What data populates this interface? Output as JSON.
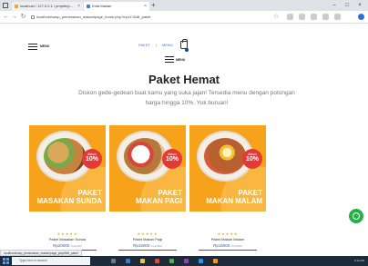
{
  "browser": {
    "tabs": [
      {
        "label": "localhost / 127.0.0.1 / pmphb/p..."
      },
      {
        "label": "Kota Makan"
      }
    ],
    "new_tab_label": "+",
    "url": "localhost/uasp_pemesanan_makan/page_home.php?mpr1?&olt_paket",
    "window_controls": [
      "–",
      "□",
      "×"
    ]
  },
  "header": {
    "menu_label": "MENU",
    "nav_links": [
      "PAKET",
      "|",
      "MENU"
    ],
    "secondary_menu_label": "MENU"
  },
  "hero": {
    "title": "Paket Hemat",
    "subtitle": "Diskon gede-gedean buat kamu yang suka jajan! Tersedia menu dengan potongan harga hingga 10%. Yuk buruan!"
  },
  "products": [
    {
      "badge_top": "diskon",
      "badge_value": "10%",
      "banner_line1": "PAKET",
      "banner_line2": "MASAKAN SUNDA",
      "stars": "★★★★★",
      "name": "Paket Masakan Sunda",
      "price": "Rp20000",
      "old_price": "Rp22000"
    },
    {
      "badge_top": "diskon",
      "badge_value": "10%",
      "banner_line1": "PAKET",
      "banner_line2": "MAKAN PAGI",
      "stars": "★★★★★",
      "name": "Paket Makan Pagi",
      "price": "Rp15000",
      "old_price": "Rp16500"
    },
    {
      "badge_top": "diskon",
      "badge_value": "10%",
      "banner_line1": "PAKET",
      "banner_line2": "MAKAN MALAM",
      "stars": "★★★★★",
      "name": "Paket Makan Malam",
      "price": "Rp15000",
      "old_price": "Rp16500"
    }
  ],
  "status_url": "localhost/uasp_pemesanan_makan/page_pmp/fb/lt_paket",
  "taskbar": {
    "search_placeholder": "Type here to search",
    "clock": "9:34 PM"
  },
  "colors": {
    "card_orange": "#f7a21b",
    "discount_red": "#e53935",
    "price_blue": "#2d5fb8",
    "whatsapp_green": "#27b047"
  }
}
